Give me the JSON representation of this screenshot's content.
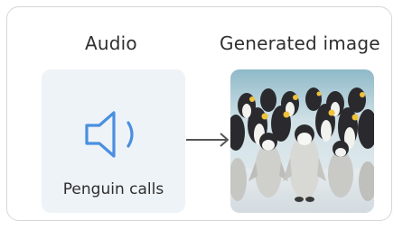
{
  "headings": {
    "audio": "Audio",
    "generated_image": "Generated image"
  },
  "audio_panel": {
    "caption": "Penguin calls",
    "icon": "speaker-icon"
  },
  "connector": {
    "icon": "arrow-right-icon"
  },
  "image_panel": {
    "depicts": "penguin-photo"
  },
  "colors": {
    "icon_blue": "#4a8fe0",
    "panel_bg": "#eef3f8",
    "arrow_gray": "#555555",
    "text": "#2f2f2f",
    "border": "#d6d6d6"
  }
}
